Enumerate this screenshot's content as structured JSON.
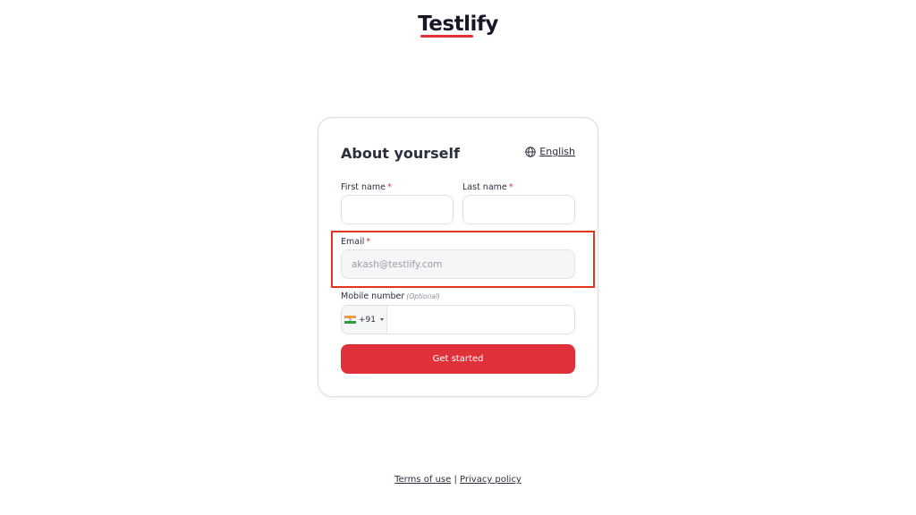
{
  "brand": {
    "name": "Testlify"
  },
  "form": {
    "title": "About yourself",
    "language": "English",
    "first_name": {
      "label": "First name",
      "required_mark": "*",
      "value": ""
    },
    "last_name": {
      "label": "Last name",
      "required_mark": "*",
      "value": ""
    },
    "email": {
      "label": "Email",
      "required_mark": "*",
      "value": "akash@testlify.com"
    },
    "mobile": {
      "label": "Mobile number",
      "optional_note": "(Optional)",
      "country_code": "+91",
      "country_flag": "india-flag-icon",
      "value": ""
    },
    "submit_label": "Get started"
  },
  "footer": {
    "terms_label": "Terms of use",
    "separator": "|",
    "privacy_label": "Privacy policy"
  },
  "colors": {
    "accent": "#e0313b",
    "highlight": "#e3341e",
    "text": "#2b2e3f"
  }
}
